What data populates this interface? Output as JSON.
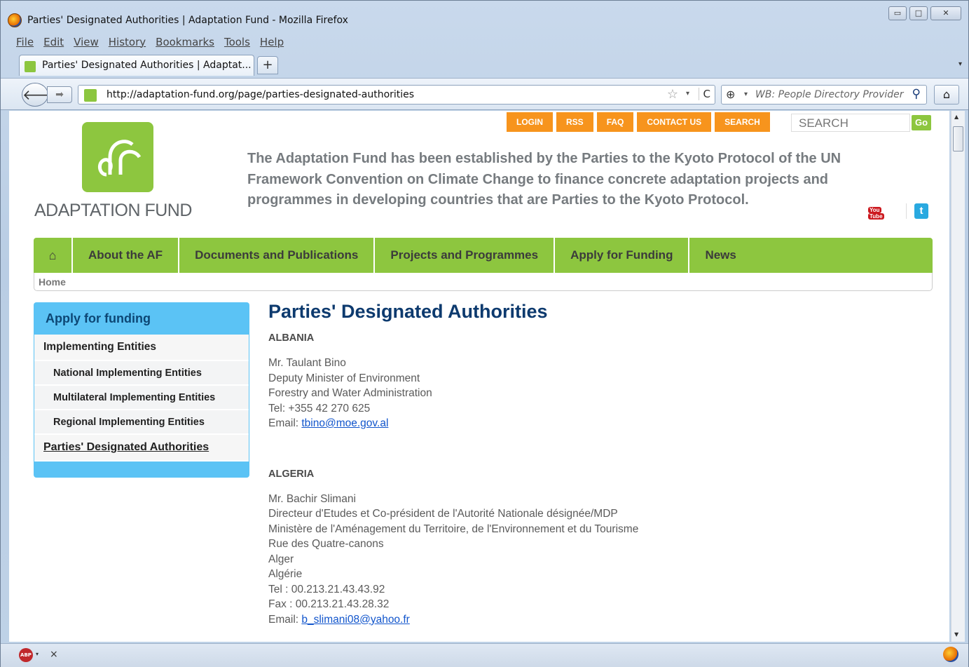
{
  "browser": {
    "window_title": "Parties' Designated Authorities | Adaptation Fund - Mozilla Firefox",
    "menu": [
      "File",
      "Edit",
      "View",
      "History",
      "Bookmarks",
      "Tools",
      "Help"
    ],
    "tab_title": "Parties' Designated Authorities | Adaptat...",
    "new_tab": "+",
    "url": "http://adaptation-fund.org/page/parties-designated-authorities",
    "search_placeholder": "WB: People Directory Provider",
    "status_close": "×"
  },
  "site": {
    "logo_text": "ADAPTATION FUND",
    "top_links": [
      "LOGIN",
      "RSS",
      "FAQ",
      "CONTACT US",
      "SEARCH"
    ],
    "search_placeholder": "SEARCH",
    "go_label": "Go",
    "tagline": "The Adaptation Fund has been established by the Parties to the Kyoto Protocol of the UN Framework Convention on Climate Change to finance concrete adaptation projects and programmes in developing countries that are Parties to the Kyoto Protocol.",
    "youtube_label": "You",
    "youtube_tube": "Tube",
    "twitter_label": "t"
  },
  "mainnav": [
    "About the AF",
    "Documents and Publications",
    "Projects and Programmes",
    "Apply for Funding",
    "News"
  ],
  "breadcrumb": "Home",
  "sidebar": {
    "header": "Apply for funding",
    "items": [
      "Implementing Entities",
      "National Implementing Entities",
      "Multilateral Implementing Entities",
      "Regional Implementing Entities",
      "Parties' Designated Authorities"
    ]
  },
  "page": {
    "title": "Parties' Designated Authorities",
    "entries": [
      {
        "country": "ALBANIA",
        "lines": [
          "Mr. Taulant Bino",
          "Deputy Minister of Environment",
          "Forestry and Water Administration",
          "Tel: +355 42 270 625"
        ],
        "email_label": "Email: ",
        "email": "tbino@moe.gov.al"
      },
      {
        "country": "ALGERIA",
        "lines": [
          "Mr. Bachir Slimani",
          "Directeur d'Etudes et Co-président de l'Autorité Nationale désignée/MDP",
          "Ministère de l'Aménagement du Territoire, de l'Environnement et du Tourisme",
          "Rue des Quatre-canons",
          "Alger",
          "Algérie",
          "Tel : 00.213.21.43.43.92",
          "Fax : 00.213.21.43.28.32"
        ],
        "email_label": "Email: ",
        "email": "b_slimani08@yahoo.fr"
      }
    ]
  }
}
